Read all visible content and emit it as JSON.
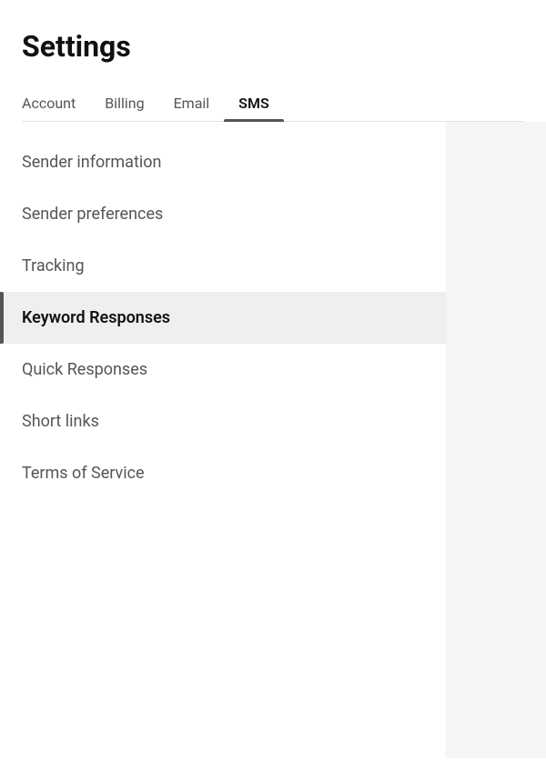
{
  "page": {
    "title": "Settings"
  },
  "tabs": {
    "items": [
      {
        "id": "account",
        "label": "Account",
        "active": false
      },
      {
        "id": "billing",
        "label": "Billing",
        "active": false
      },
      {
        "id": "email",
        "label": "Email",
        "active": false
      },
      {
        "id": "sms",
        "label": "SMS",
        "active": true
      }
    ]
  },
  "sidebar": {
    "items": [
      {
        "id": "sender-information",
        "label": "Sender information",
        "active": false
      },
      {
        "id": "sender-preferences",
        "label": "Sender preferences",
        "active": false
      },
      {
        "id": "tracking",
        "label": "Tracking",
        "active": false
      },
      {
        "id": "keyword-responses",
        "label": "Keyword Responses",
        "active": true
      },
      {
        "id": "quick-responses",
        "label": "Quick Responses",
        "active": false
      },
      {
        "id": "short-links",
        "label": "Short links",
        "active": false
      },
      {
        "id": "terms-of-service",
        "label": "Terms of Service",
        "active": false
      }
    ]
  }
}
